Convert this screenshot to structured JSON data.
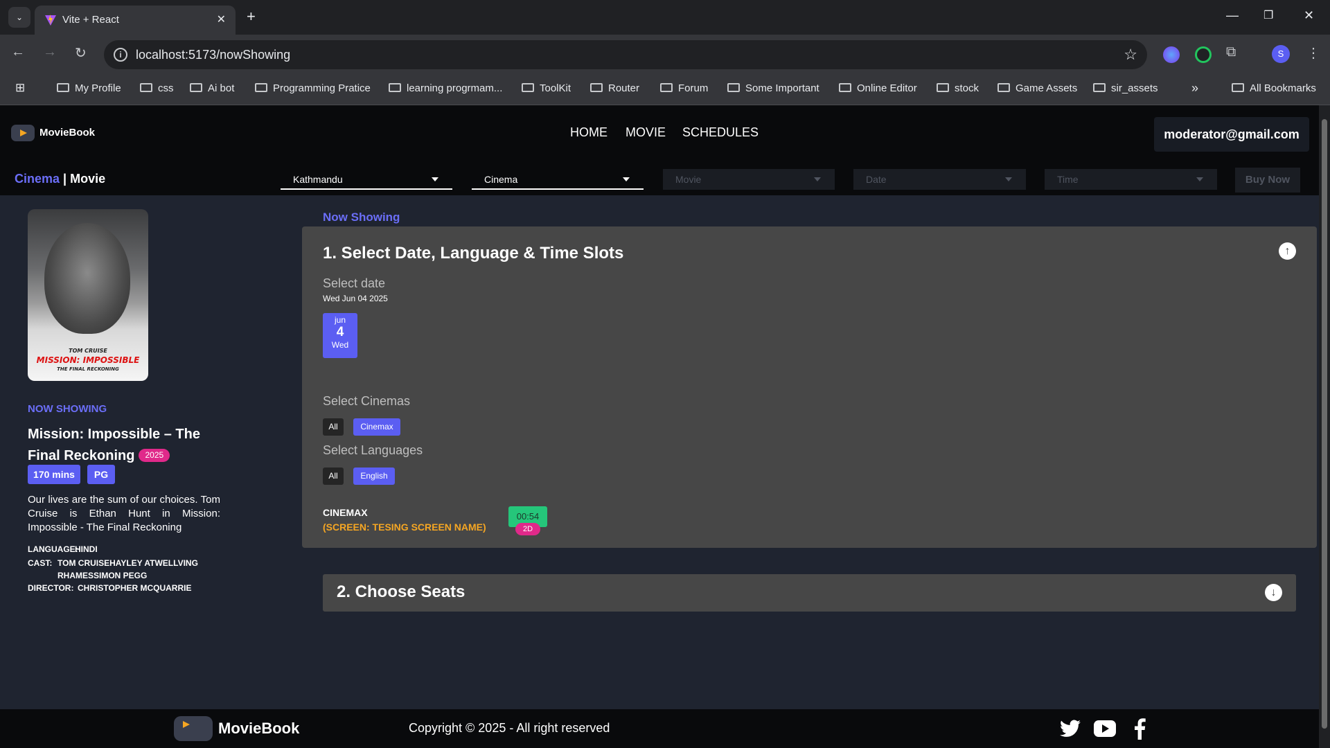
{
  "browser": {
    "tab_title": "Vite + React",
    "url": "localhost:5173/nowShowing",
    "profile_initial": "S",
    "bookmarks": [
      "My Profile",
      "css",
      "Ai bot",
      "Programming Pratice",
      "learning progrmam...",
      "ToolKit",
      "Router",
      "Forum",
      "Some Important",
      "Online Editor",
      "stock",
      "Game Assets",
      "sir_assets"
    ],
    "all_bookmarks": "All Bookmarks",
    "more_glyph": "»"
  },
  "header": {
    "brand": "MovieBook",
    "nav": [
      "HOME",
      "MOVIE",
      "SCHEDULES"
    ],
    "user_email": "moderator@gmail.com",
    "cinema_label": "Cinema",
    "movie_label": "| Movie"
  },
  "filters": {
    "city": "Kathmandu",
    "cinema": "Cinema",
    "movie": "Movie",
    "date": "Date",
    "time": "Time",
    "buy_now": "Buy Now"
  },
  "movie": {
    "status": "NOW SHOWING",
    "title": "Mission: Impossible – The Final Reckoning",
    "year": "2025",
    "duration": "170 mins",
    "rating": "PG",
    "description": "Our lives are the sum of our choices. Tom Cruise is Ethan Hunt in Mission: Impossible - The Final Reckoning",
    "language_label": "LANGUAGE:",
    "language": "HINDI",
    "cast_label": "CAST:",
    "cast": "TOM CRUISEHAYLEY ATWELLVING RHAMESSIMON PEGG",
    "director_label": "DIRECTOR:",
    "director": "CHRISTOPHER MCQUARRIE",
    "poster_text": {
      "actor": "TOM CRUISE",
      "title": "MISSION: IMPOSSIBLE",
      "subtitle": "THE FINAL RECKONING"
    }
  },
  "booking": {
    "now_showing": "Now Showing",
    "step1_title": "1. Select Date, Language & Time Slots",
    "select_date_label": "Select date",
    "selected_date": "Wed Jun 04 2025",
    "date_card": {
      "month": "jun",
      "day": "4",
      "weekday": "Wed"
    },
    "select_cinemas_label": "Select Cinemas",
    "cinema_chips": [
      "All",
      "Cinemax"
    ],
    "select_languages_label": "Select Languages",
    "language_chips": [
      "All",
      "English"
    ],
    "cinema_name": "CINEMAX",
    "screen_name": "(SCREEN: TESING SCREEN NAME)",
    "showtime": "00:54",
    "format": "2D",
    "step2_title": "2. Choose Seats"
  },
  "footer": {
    "brand": "MovieBook",
    "copyright": "Copyright © 2025 - All right reserved"
  },
  "colors": {
    "accent": "#5b5ef2",
    "pink": "#e0298a",
    "orange": "#f5a623",
    "green": "#25c67a"
  }
}
